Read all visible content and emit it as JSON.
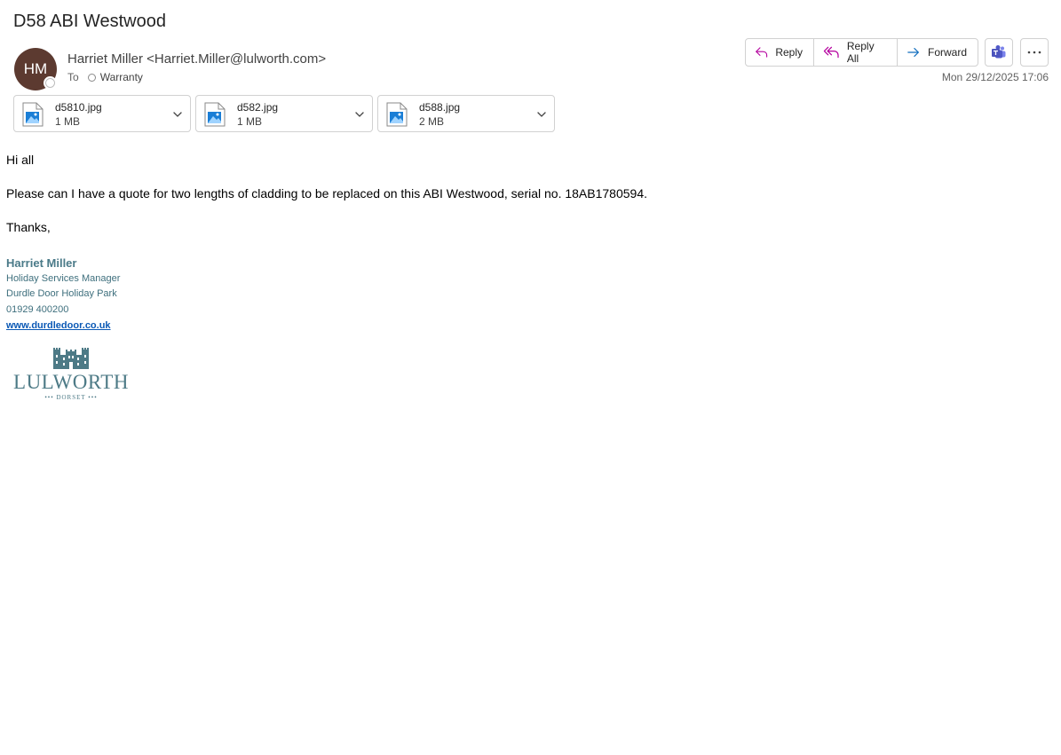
{
  "email": {
    "subject": "D58 ABI Westwood",
    "sender_initials": "HM",
    "sender_display": "Harriet Miller <Harriet.Miller@lulworth.com>",
    "to_label": "To",
    "recipient": "Warranty",
    "date": "Mon 29/12/2025 17:06"
  },
  "actions": {
    "reply": "Reply",
    "reply_all": "Reply All",
    "forward": "Forward"
  },
  "attachments": [
    {
      "name": "d5810.jpg",
      "size": "1 MB"
    },
    {
      "name": "d582.jpg",
      "size": "1 MB"
    },
    {
      "name": "d588.jpg",
      "size": "2 MB"
    }
  ],
  "body": {
    "greeting": "Hi all",
    "message": "Please can I have a quote for two lengths of cladding to be replaced on this ABI Westwood, serial no. 18AB1780594.",
    "signoff": "Thanks,"
  },
  "signature": {
    "name": "Harriet Miller",
    "title": "Holiday Services Manager",
    "company": "Durdle Door Holiday Park",
    "phone": "01929 400200",
    "website": "www.durdledoor.co.uk",
    "logo_text": "LULWORTH",
    "logo_subtext": "••• DORSET •••"
  },
  "icons": {
    "reply": "reply-arrow-icon",
    "reply_all": "reply-all-arrow-icon",
    "forward": "forward-arrow-icon",
    "teams": "teams-icon",
    "more": "more-ellipsis-icon",
    "attachment": "image-file-icon",
    "chevron": "chevron-down-icon"
  },
  "colors": {
    "avatar_bg": "#5c3a30",
    "reply_accent": "#b4009e",
    "forward_accent": "#0f6cbd",
    "signature": "#4a7a88",
    "link": "#0b59b5"
  }
}
